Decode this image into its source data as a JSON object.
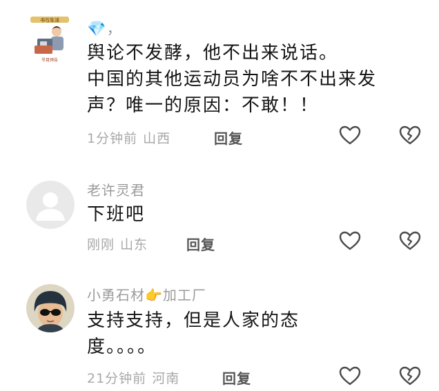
{
  "comments": [
    {
      "author": "💎，",
      "avatar_caption": "书与生活",
      "avatar_label": "节目预告",
      "lines": [
        "舆论不发酵，他不出来说话。",
        "中国的其他运动员为啥不不出来发",
        "声？唯一的原因：不敢！！"
      ],
      "time": "1分钟前",
      "location": "山西",
      "reply": "回复"
    },
    {
      "author": "老许灵君",
      "lines": [
        "下班吧"
      ],
      "time": "刚刚",
      "location": "山东",
      "reply": "回复"
    },
    {
      "author": "小勇石材👉加工厂",
      "lines": [
        "支持支持，但是人家的态",
        "度。。。。"
      ],
      "time": "21分钟前",
      "location": "河南",
      "reply": "回复"
    }
  ],
  "icons": {
    "like": "heart-outline-icon",
    "dislike": "broken-heart-icon"
  }
}
